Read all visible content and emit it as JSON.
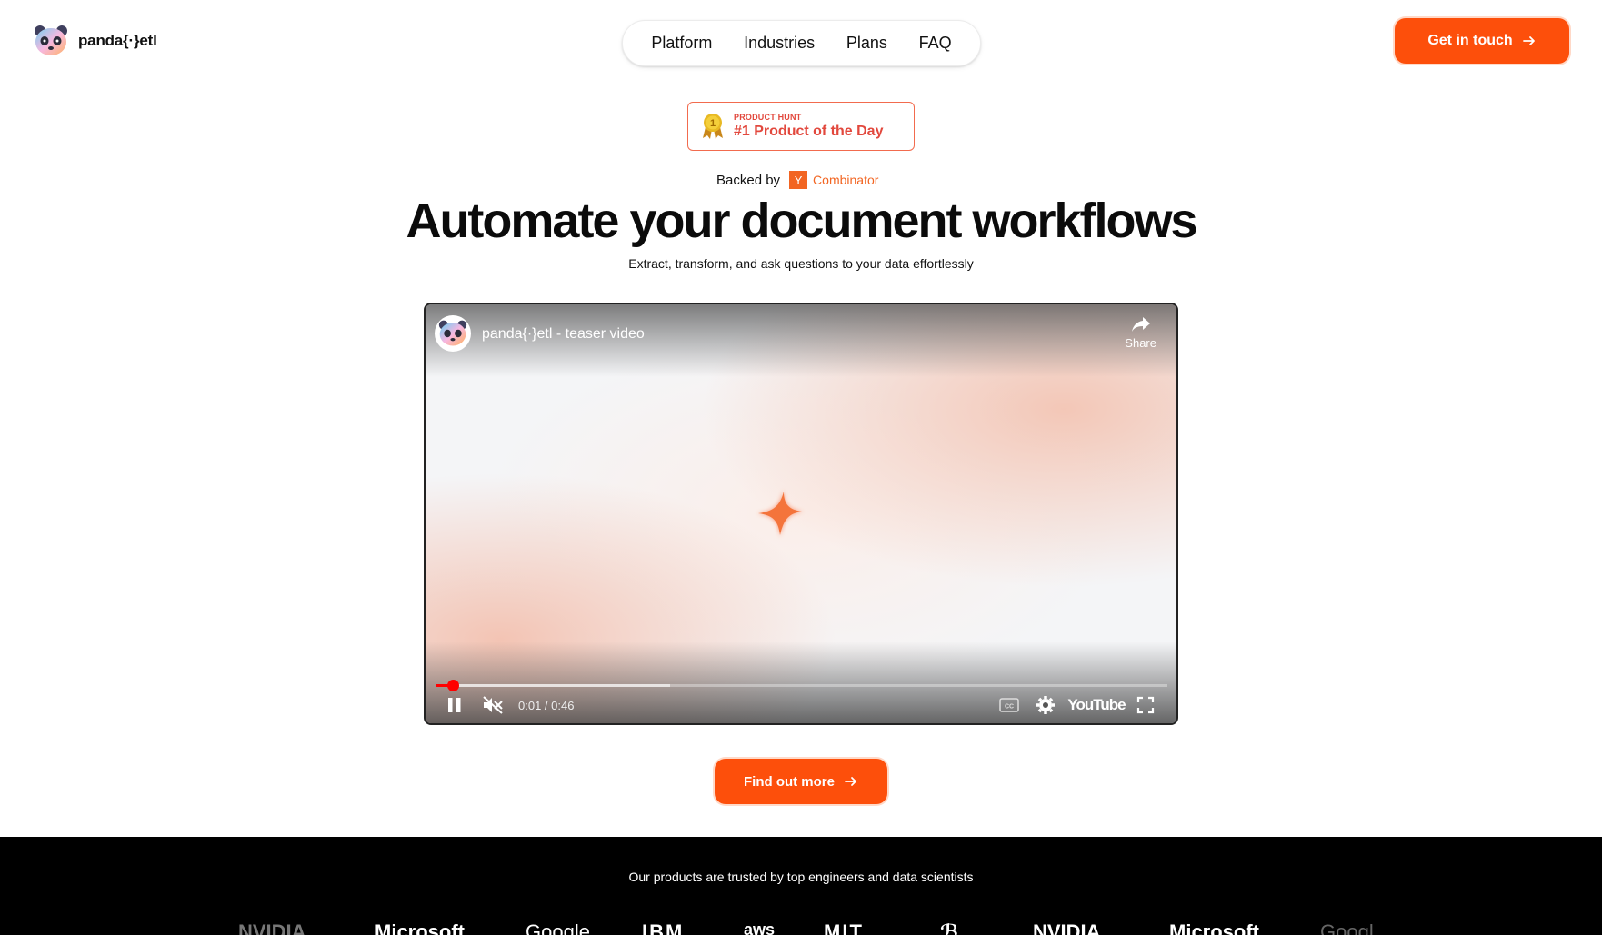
{
  "brand": {
    "name": "panda{·}etl"
  },
  "nav": {
    "items": [
      "Platform",
      "Industries",
      "Plans",
      "FAQ"
    ]
  },
  "header_cta": {
    "label": "Get in touch"
  },
  "product_hunt": {
    "small": "PRODUCT HUNT",
    "big": "#1 Product of the Day",
    "rank": "1"
  },
  "backed": {
    "label": "Backed by",
    "yc_letter": "Y",
    "yc_name": "Combinator"
  },
  "hero": {
    "headline": "Automate your document workflows",
    "subhead": "Extract, transform, and ask questions to your data effortlessly"
  },
  "video": {
    "title": "panda{·}etl - teaser video",
    "share_label": "Share",
    "time": "0:01 / 0:46",
    "played_fraction": 0.022,
    "buffered_fraction": 0.32,
    "youtube_label": "YouTube",
    "cc_label": "CC"
  },
  "find_out_more": {
    "label": "Find out more"
  },
  "trusted": {
    "text": "Our products are trusted by top engineers and data scientists",
    "logos": [
      "NVIDIA",
      "Microsoft",
      "Google",
      "IBM",
      "aws",
      "MIT",
      "ℬ",
      "NVIDIA",
      "Microsoft",
      "Googl"
    ]
  },
  "colors": {
    "accent": "#fd4f0b",
    "product_hunt": "#e2483d",
    "yc": "#f26522"
  }
}
